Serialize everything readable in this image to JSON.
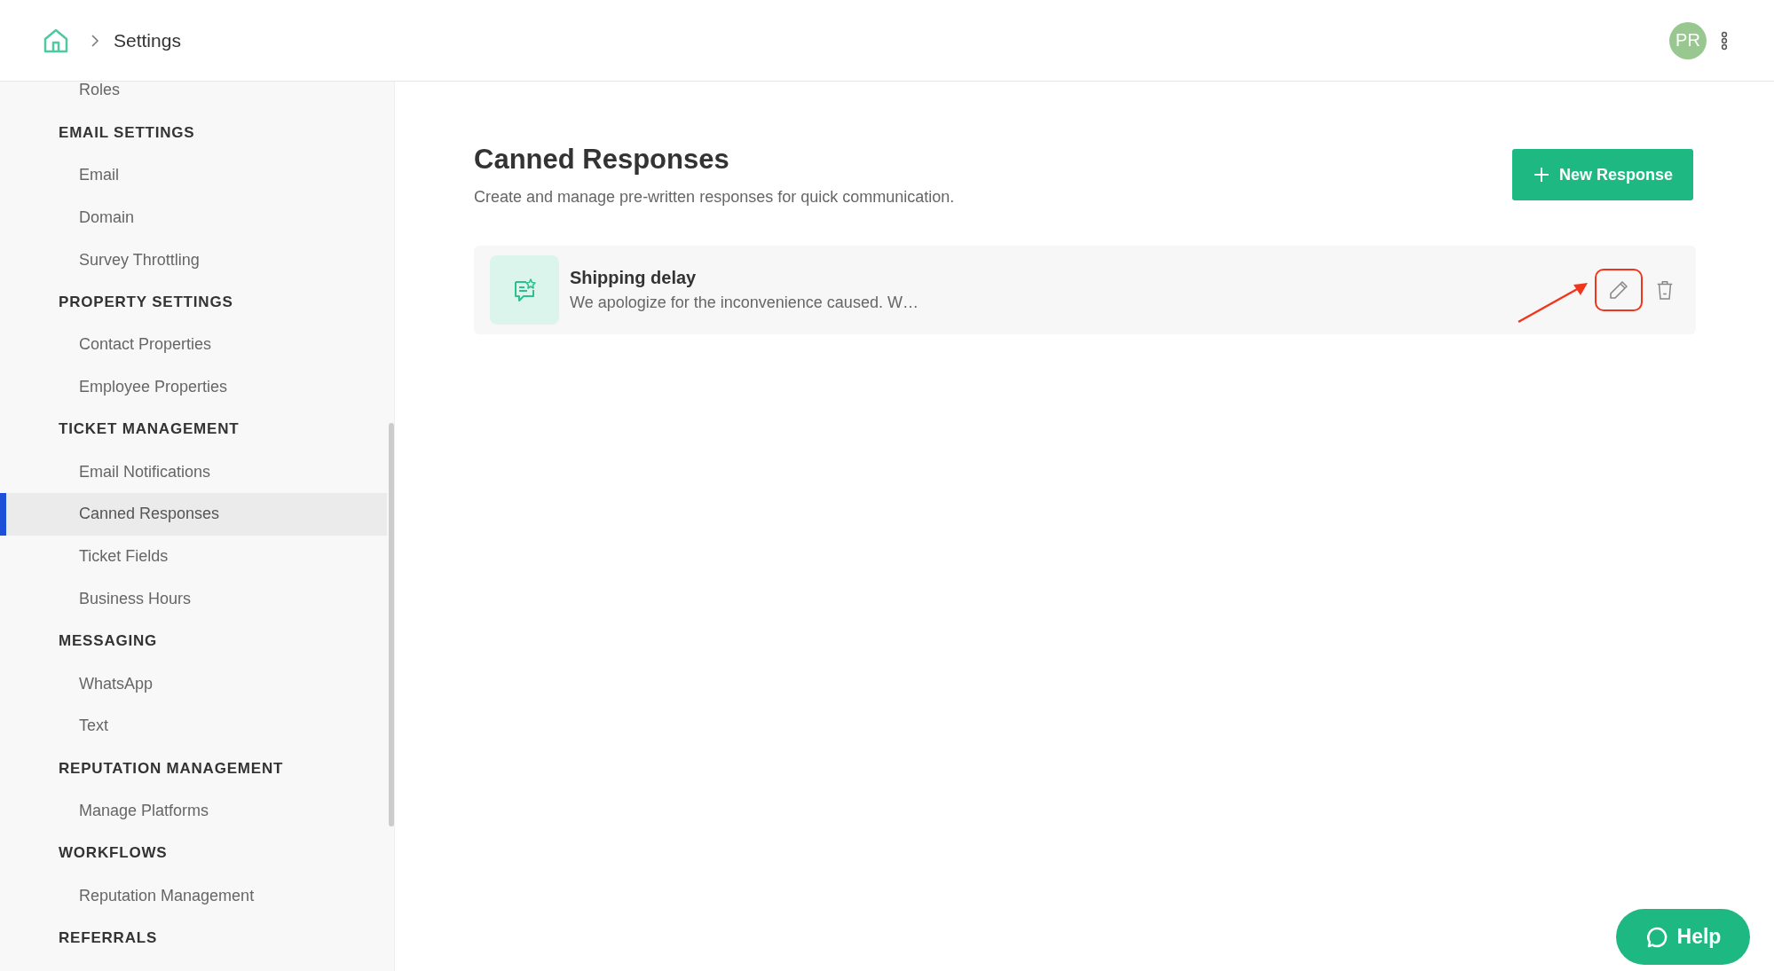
{
  "breadcrumb": {
    "current": "Settings"
  },
  "user": {
    "initials": "PR"
  },
  "sidebar": {
    "items": [
      {
        "kind": "item",
        "label": "Roles",
        "selected": false
      },
      {
        "kind": "heading",
        "label": "EMAIL SETTINGS"
      },
      {
        "kind": "item",
        "label": "Email",
        "selected": false
      },
      {
        "kind": "item",
        "label": "Domain",
        "selected": false
      },
      {
        "kind": "item",
        "label": "Survey Throttling",
        "selected": false
      },
      {
        "kind": "heading",
        "label": "PROPERTY SETTINGS"
      },
      {
        "kind": "item",
        "label": "Contact Properties",
        "selected": false
      },
      {
        "kind": "item",
        "label": "Employee Properties",
        "selected": false
      },
      {
        "kind": "heading",
        "label": "TICKET MANAGEMENT"
      },
      {
        "kind": "item",
        "label": "Email Notifications",
        "selected": false
      },
      {
        "kind": "item",
        "label": "Canned Responses",
        "selected": true
      },
      {
        "kind": "item",
        "label": "Ticket Fields",
        "selected": false
      },
      {
        "kind": "item",
        "label": "Business Hours",
        "selected": false
      },
      {
        "kind": "heading",
        "label": "MESSAGING"
      },
      {
        "kind": "item",
        "label": "WhatsApp",
        "selected": false
      },
      {
        "kind": "item",
        "label": "Text",
        "selected": false
      },
      {
        "kind": "heading",
        "label": "REPUTATION MANAGEMENT"
      },
      {
        "kind": "item",
        "label": "Manage Platforms",
        "selected": false
      },
      {
        "kind": "heading",
        "label": "WORKFLOWS"
      },
      {
        "kind": "item",
        "label": "Reputation Management",
        "selected": false
      },
      {
        "kind": "heading",
        "label": "REFERRALS"
      }
    ]
  },
  "page": {
    "title": "Canned Responses",
    "subtitle": "Create and manage pre-written responses for quick communication.",
    "new_button": "New Response"
  },
  "responses": [
    {
      "title": "Shipping delay",
      "preview": "We apologize for the inconvenience caused. W…",
      "highlight_edit": true
    }
  ],
  "help_button": "Help"
}
